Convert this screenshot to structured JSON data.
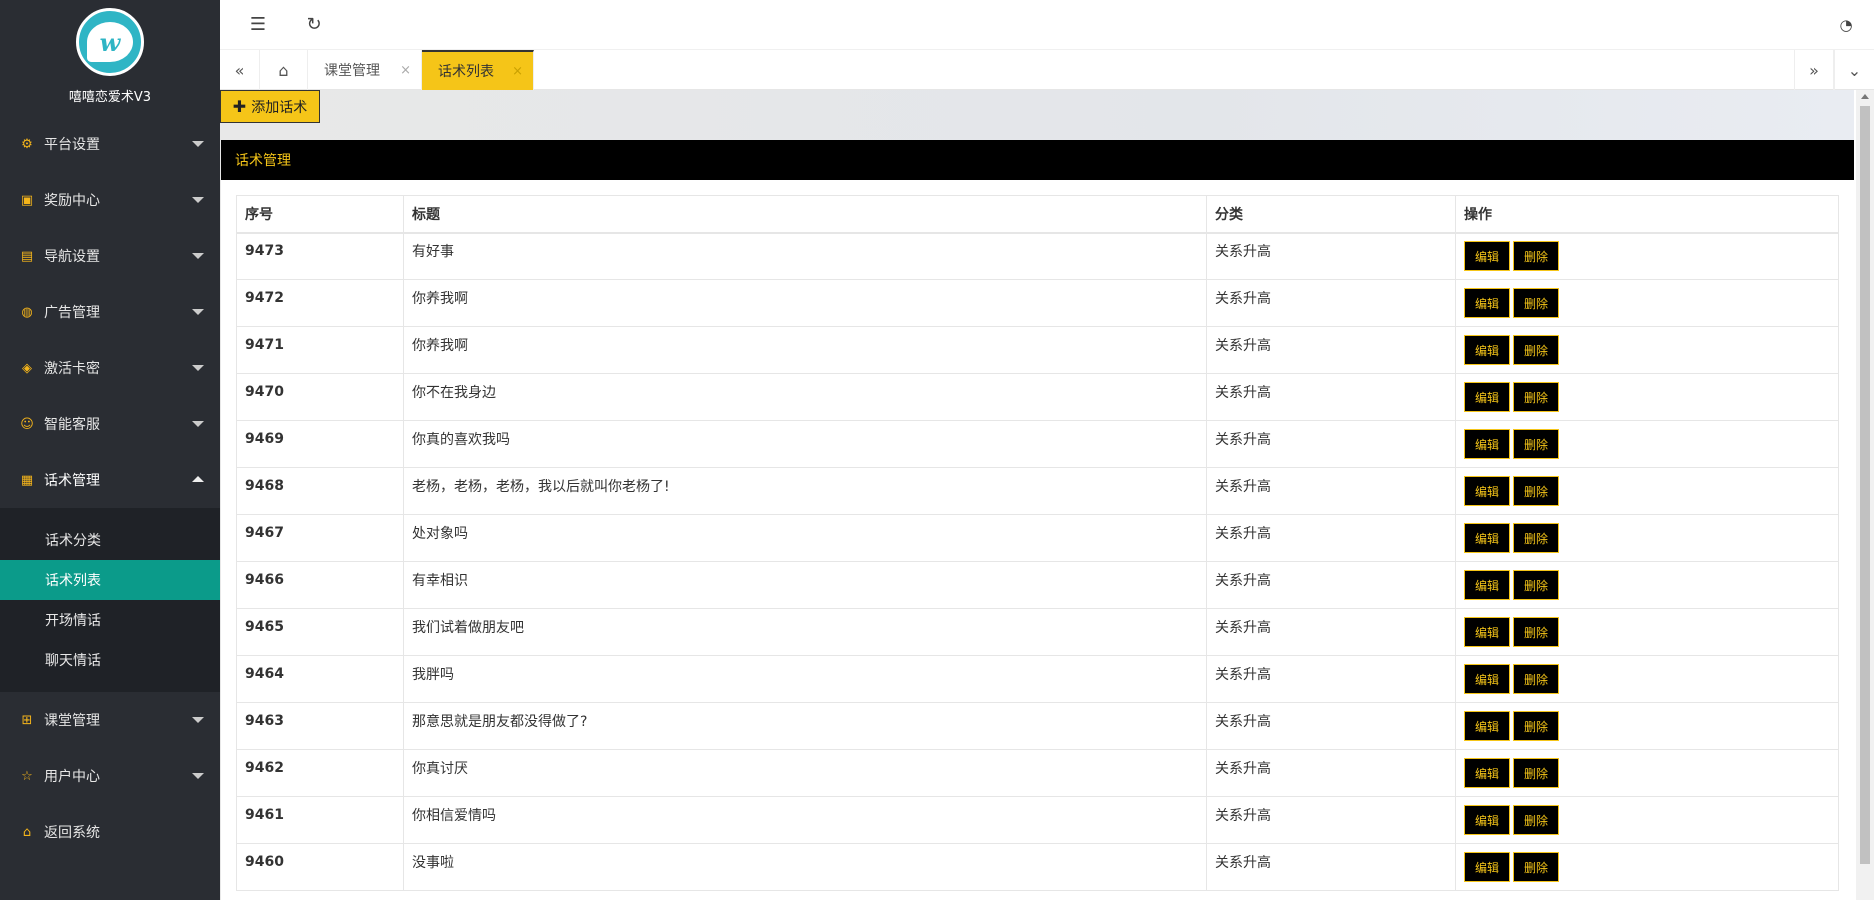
{
  "app": {
    "name": "嘻嘻恋爱术V3"
  },
  "sidebar": {
    "items": [
      {
        "label": "平台设置",
        "icon": "gear-icon"
      },
      {
        "label": "奖励中心",
        "icon": "video-icon"
      },
      {
        "label": "导航设置",
        "icon": "book-icon"
      },
      {
        "label": "广告管理",
        "icon": "palette-icon"
      },
      {
        "label": "激活卡密",
        "icon": "cube-icon"
      },
      {
        "label": "智能客服",
        "icon": "smile-icon"
      },
      {
        "label": "话术管理",
        "icon": "file-icon"
      }
    ],
    "submenu": [
      {
        "label": "话术分类"
      },
      {
        "label": "话术列表"
      },
      {
        "label": "开场情话"
      },
      {
        "label": "聊天情话"
      }
    ],
    "bottom_items": [
      {
        "label": "课堂管理",
        "icon": "read-icon"
      },
      {
        "label": "用户中心",
        "icon": "star-icon"
      },
      {
        "label": "返回系统",
        "icon": "home-icon"
      }
    ]
  },
  "tabs": [
    {
      "label": "课堂管理",
      "close": "×"
    },
    {
      "label": "话术列表",
      "close": "×"
    }
  ],
  "toolbar": {
    "add_label": "添加话术"
  },
  "panel": {
    "title": "话术管理"
  },
  "table": {
    "headers": [
      "序号",
      "标题",
      "分类",
      "操作"
    ],
    "edit_label": "编辑",
    "delete_label": "删除",
    "rows": [
      {
        "id": "9473",
        "title": "有好事",
        "category": "关系升高"
      },
      {
        "id": "9472",
        "title": "你养我啊",
        "category": "关系升高"
      },
      {
        "id": "9471",
        "title": "你养我啊",
        "category": "关系升高"
      },
      {
        "id": "9470",
        "title": "你不在我身边",
        "category": "关系升高"
      },
      {
        "id": "9469",
        "title": "你真的喜欢我吗",
        "category": "关系升高"
      },
      {
        "id": "9468",
        "title": "老杨，老杨，老杨，我以后就叫你老杨了!",
        "category": "关系升高"
      },
      {
        "id": "9467",
        "title": "处对象吗",
        "category": "关系升高"
      },
      {
        "id": "9466",
        "title": "有幸相识",
        "category": "关系升高"
      },
      {
        "id": "9465",
        "title": "我们试着做朋友吧",
        "category": "关系升高"
      },
      {
        "id": "9464",
        "title": "我胖吗",
        "category": "关系升高"
      },
      {
        "id": "9463",
        "title": "那意思就是朋友都没得做了?",
        "category": "关系升高"
      },
      {
        "id": "9462",
        "title": "你真讨厌",
        "category": "关系升高"
      },
      {
        "id": "9461",
        "title": "你相信爱情吗",
        "category": "关系升高"
      },
      {
        "id": "9460",
        "title": "没事啦",
        "category": "关系升高"
      }
    ]
  },
  "colors": {
    "accent": "#f5c518",
    "sidebar_bg": "#2a2d33",
    "active_sub": "#0b9b8a"
  }
}
